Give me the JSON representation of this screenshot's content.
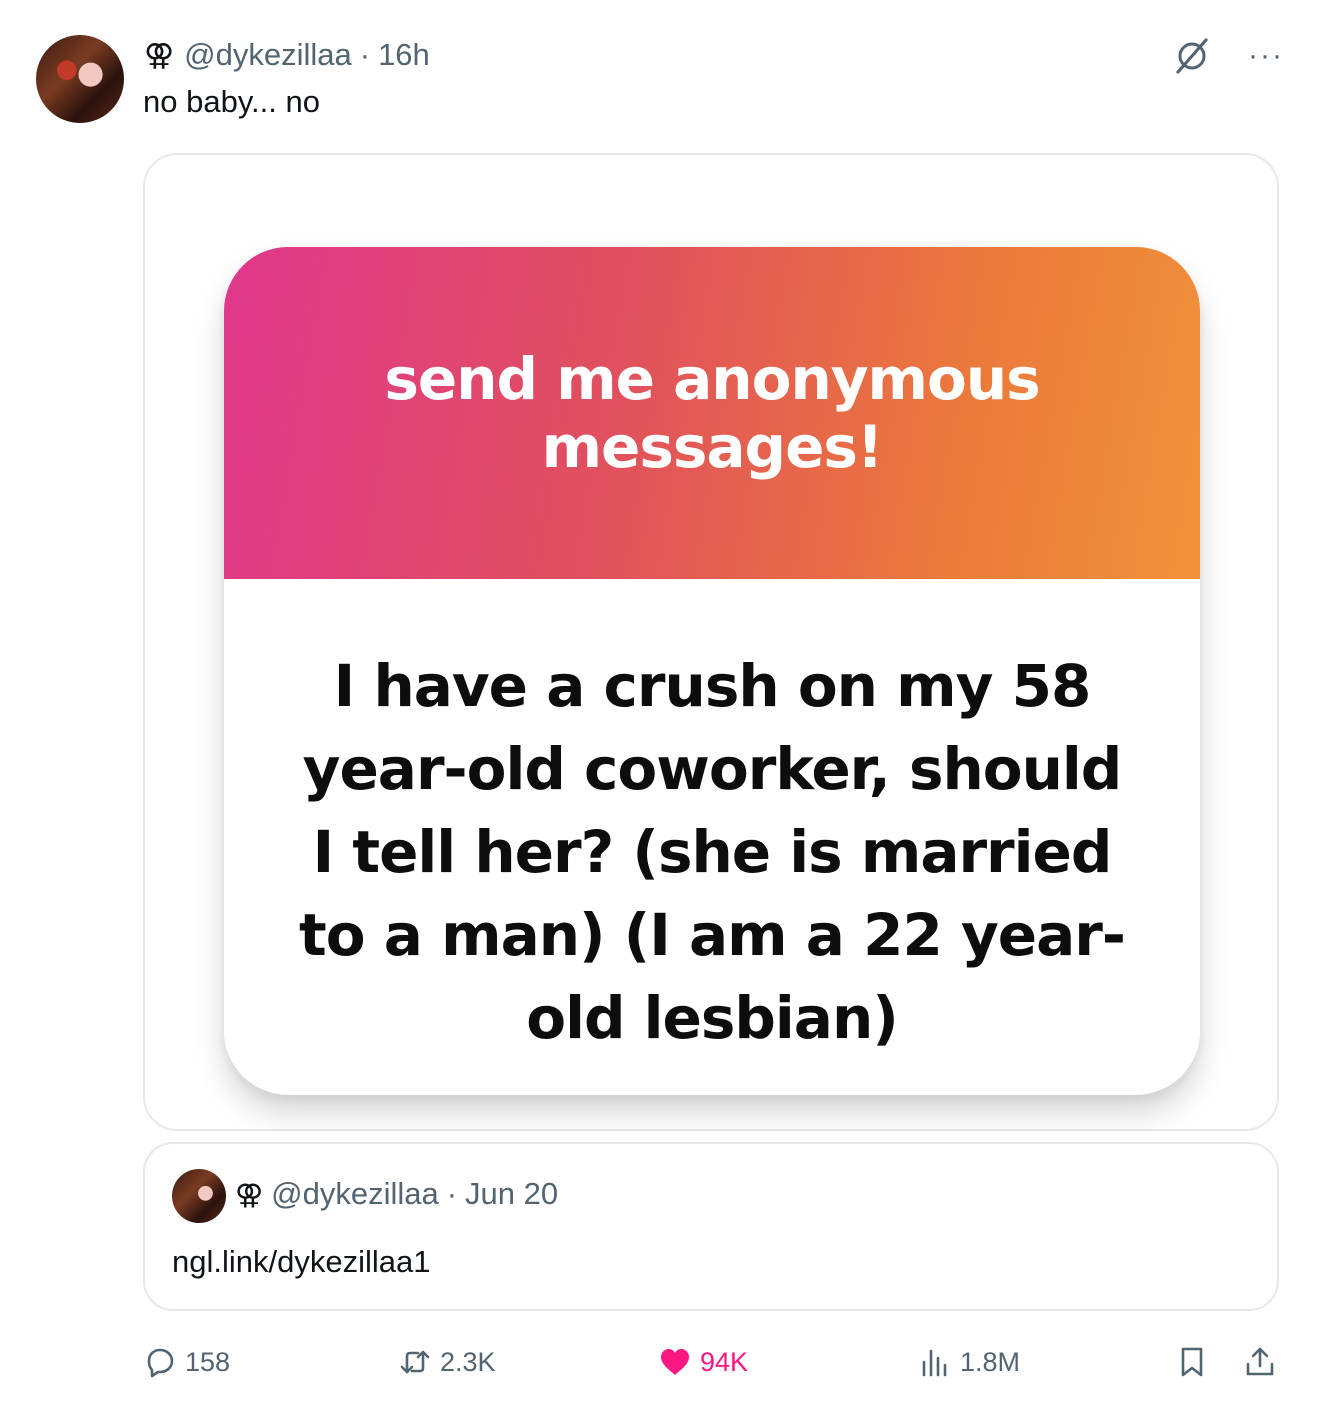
{
  "tweet": {
    "author_symbol": "⚢",
    "handle": "@dykezillaa",
    "separator": "·",
    "time": "16h",
    "text": "no baby... no",
    "more_label": "···"
  },
  "media": {
    "banner_title": "send me anonymous messages!",
    "message": "I have a crush on my 58 year-old coworker, should I tell her? (she is married to a man) (I am a 22 year-old lesbian)",
    "banner_colors": [
      "#e0378c",
      "#f0923a"
    ]
  },
  "quote": {
    "author_symbol": "⚢",
    "handle": "@dykezillaa",
    "separator": "·",
    "date": "Jun 20",
    "text": "ngl.link/dykezillaa1"
  },
  "actions": {
    "replies": "158",
    "reposts": "2.3K",
    "likes": "94K",
    "views": "1.8M",
    "like_color": "#f91880",
    "icons": [
      "reply-icon",
      "repost-icon",
      "heart-icon",
      "views-icon",
      "bookmark-icon",
      "share-icon"
    ]
  }
}
